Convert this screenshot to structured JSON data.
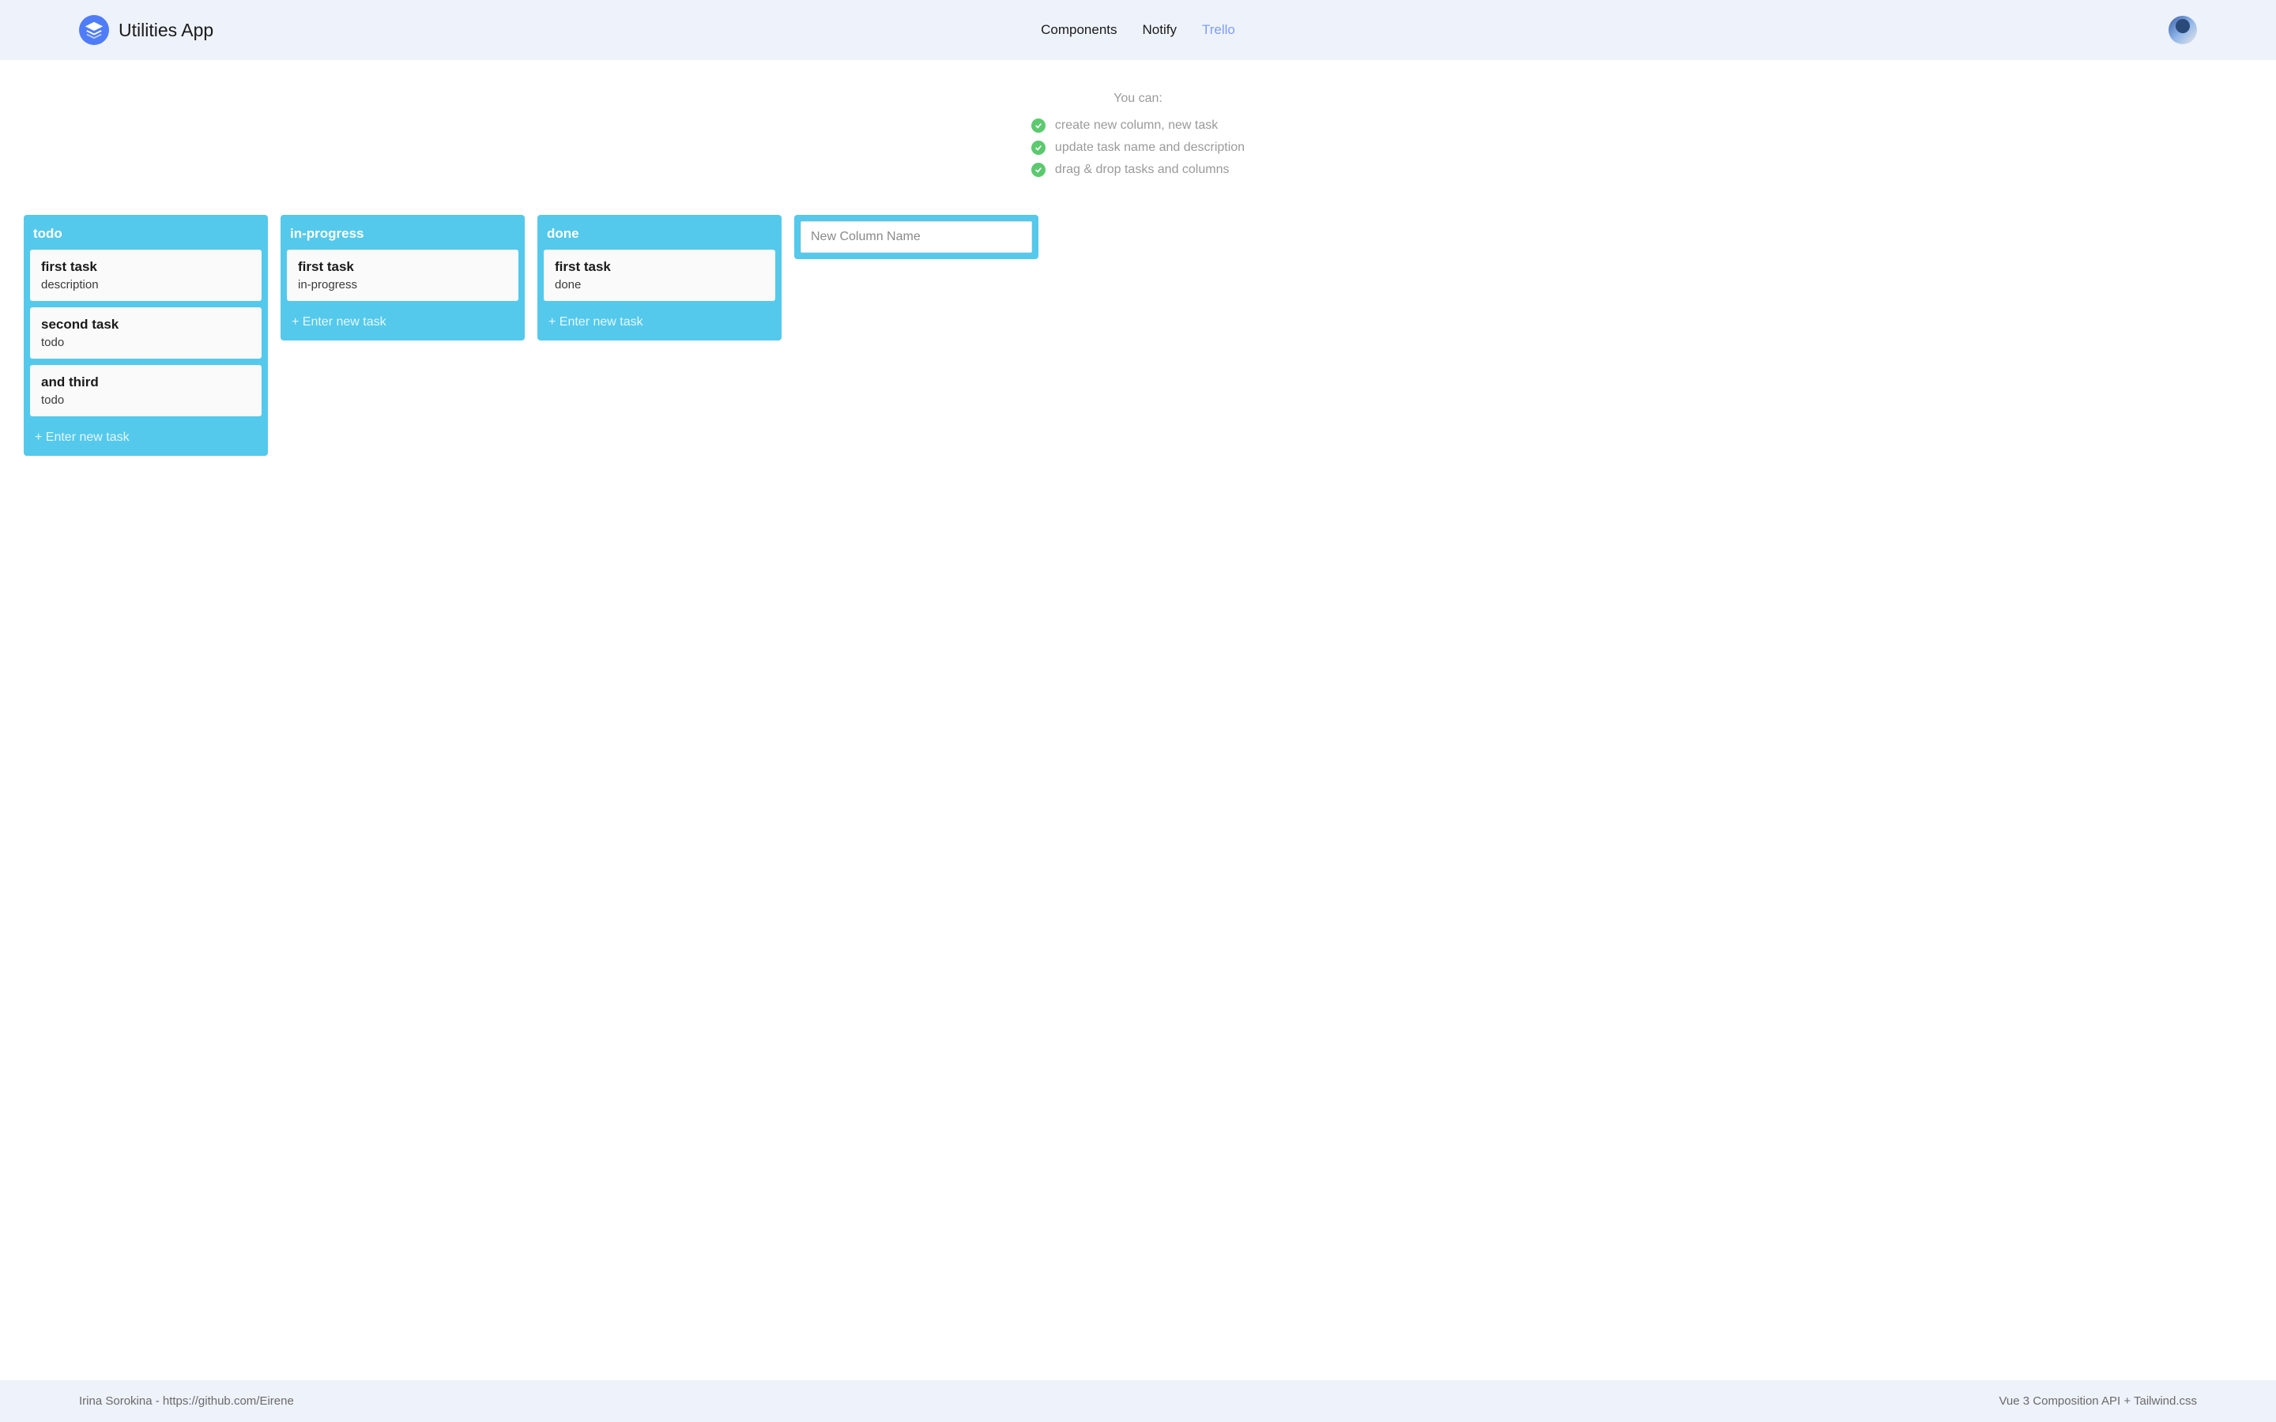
{
  "header": {
    "app_title": "Utilities App",
    "nav": [
      {
        "label": "Components",
        "active": false
      },
      {
        "label": "Notify",
        "active": false
      },
      {
        "label": "Trello",
        "active": true
      }
    ]
  },
  "instructions": {
    "title": "You can:",
    "items": [
      "create new column, new task",
      "update task name and description",
      "drag & drop tasks and columns"
    ]
  },
  "board": {
    "columns": [
      {
        "name": "todo",
        "tasks": [
          {
            "title": "first task",
            "description": "description"
          },
          {
            "title": "second task",
            "description": "todo"
          },
          {
            "title": "and third",
            "description": "todo"
          }
        ]
      },
      {
        "name": "in-progress",
        "tasks": [
          {
            "title": "first task",
            "description": "in-progress"
          }
        ]
      },
      {
        "name": "done",
        "tasks": [
          {
            "title": "first task",
            "description": "done"
          }
        ]
      }
    ],
    "new_task_placeholder": "+ Enter new task",
    "new_column_placeholder": "New Column Name"
  },
  "footer": {
    "left": "Irina Sorokina - https://github.com/Eirene",
    "right": "Vue 3 Composition API + Tailwind.css"
  },
  "colors": {
    "header_bg": "#eef2fb",
    "column_bg": "#54c9eb",
    "logo_bg": "#4f7df9",
    "check_bg": "#5cc96f",
    "active_nav": "#7e9df9"
  }
}
